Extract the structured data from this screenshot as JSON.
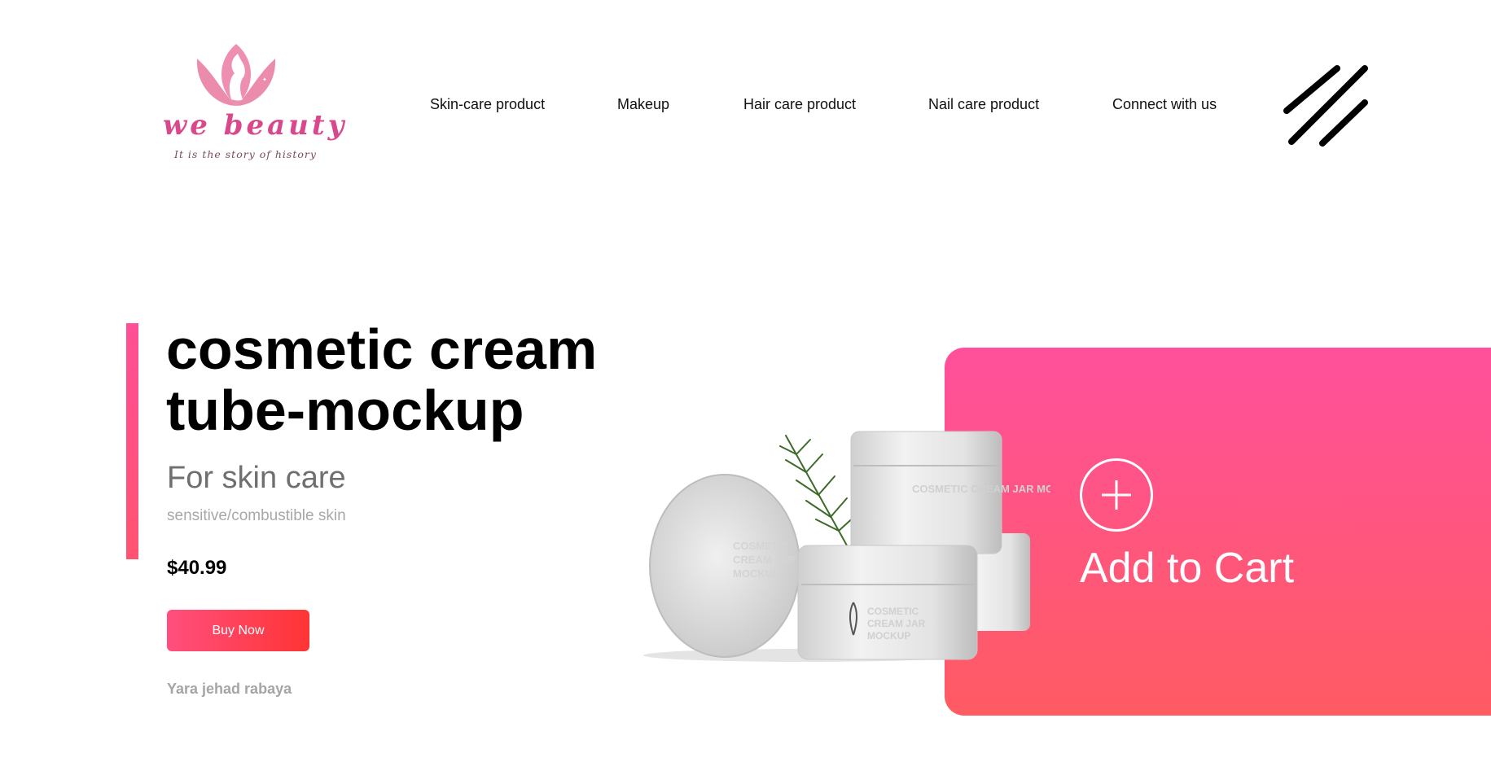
{
  "brand": {
    "name": "we beauty",
    "tagline": "It is the story of history",
    "logo_icon": "lotus-woman-logo",
    "color": "#d9488a"
  },
  "nav": {
    "items": [
      {
        "label": "Skin-care product"
      },
      {
        "label": "Makeup"
      },
      {
        "label": "Hair care product"
      },
      {
        "label": "Nail care product"
      },
      {
        "label": "Connect with us"
      }
    ],
    "menu_icon": "triple-slash-menu-icon"
  },
  "hero": {
    "title": "cosmetic cream tube-mockup",
    "subtitle": "For skin care",
    "skin_type": "sensitive/combustible skin",
    "price": "$40.99",
    "buy_label": "Buy Now",
    "author": "Yara jehad rabaya",
    "accent_color": "#ff4f96"
  },
  "product_image": {
    "jar_text": "COSMETIC CREAM JAR MOCKUP"
  },
  "cart": {
    "label": "Add to Cart",
    "icon": "plus-circle-icon",
    "gradient_top": "#ff509c",
    "gradient_bottom": "#ff5b62"
  }
}
